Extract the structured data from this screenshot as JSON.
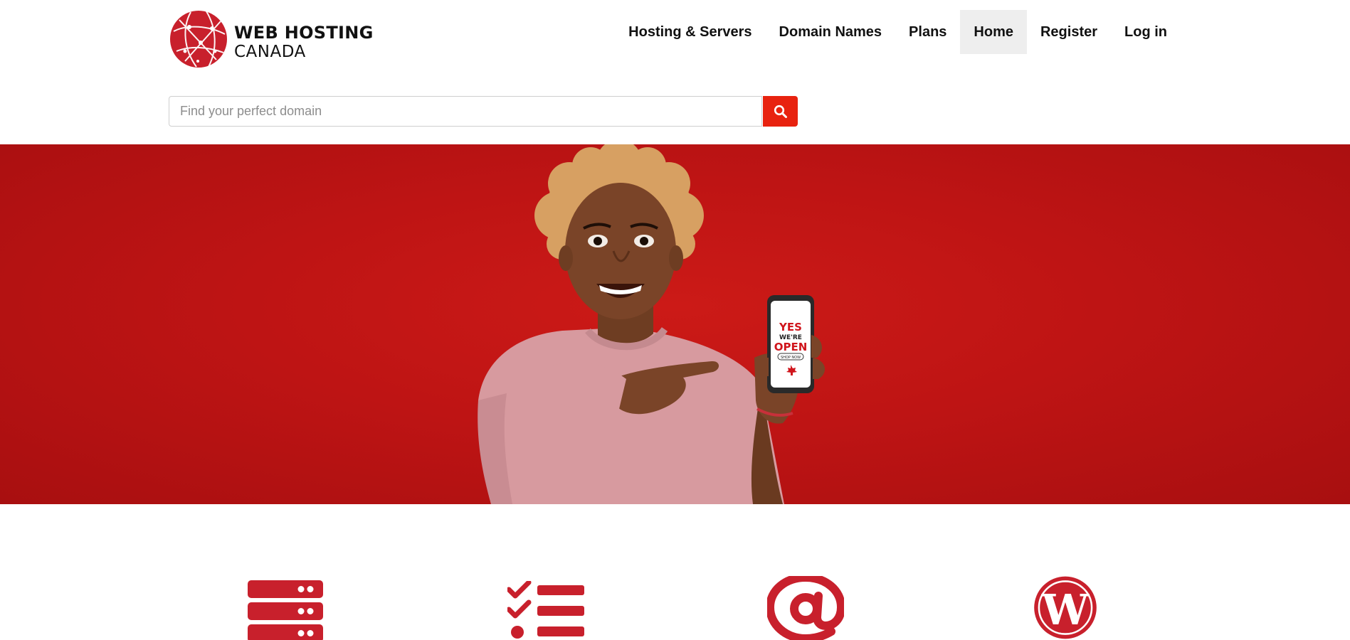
{
  "brand": {
    "name_line1": "WEB HOSTING",
    "name_line2": "CANADA",
    "logo_icon": "globe-icon",
    "color": "#c8202c"
  },
  "nav": {
    "items": [
      {
        "label": "Hosting & Servers",
        "active": false
      },
      {
        "label": "Domain Names",
        "active": false
      },
      {
        "label": "Plans",
        "active": false
      },
      {
        "label": "Home",
        "active": true
      },
      {
        "label": "Register",
        "active": false
      },
      {
        "label": "Log in",
        "active": false
      }
    ]
  },
  "search": {
    "placeholder": "Find your perfect domain",
    "value": "",
    "button_icon": "search-icon",
    "button_color": "#e8220f"
  },
  "hero": {
    "background_color": "#bf1616",
    "phone_screen": {
      "line1": "YES",
      "line2": "WE'RE",
      "line3": "OPEN",
      "button": "SHOP NOW",
      "icon": "maple-leaf-icon"
    }
  },
  "features": {
    "icon_color": "#c8202c",
    "icons": [
      "server-icon",
      "checklist-icon",
      "at-sign-icon",
      "wordpress-icon"
    ]
  }
}
